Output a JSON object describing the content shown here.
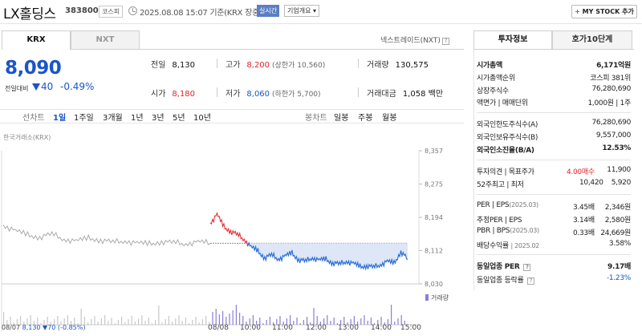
{
  "header": {
    "stock_name": "LX홀딩스",
    "stock_code": "383800",
    "market": "코스피",
    "date_text": "2025.08.08 15:07 기준(KRX 장중)",
    "realtime": "실시간",
    "company_info": "기업개요 ▾",
    "mystock_plus": "+",
    "mystock_label": "MY STOCK 추가"
  },
  "tabs": {
    "krx": "KRX",
    "nxt": "NXT",
    "nxt_link": "넥스트레이드(NXT)",
    "help": "?"
  },
  "price": {
    "current": "8,090",
    "change_label": "전일대비",
    "change_value": "40",
    "change_pct": "-0.49%"
  },
  "stats": {
    "prev_close_label": "전일",
    "prev_close": "8,130",
    "high_label": "고가",
    "high": "8,200",
    "upper_limit": "(상한가 10,560)",
    "volume_label": "거래량",
    "volume": "130,575",
    "open_label": "시가",
    "open": "8,180",
    "low_label": "저가",
    "low": "8,060",
    "lower_limit": "(하한가 5,700)",
    "amount_label": "거래대금",
    "amount": "1,058 백만"
  },
  "period": {
    "line_label": "선차트",
    "items": [
      "1일",
      "1주일",
      "3개월",
      "1년",
      "3년",
      "5년",
      "10년"
    ],
    "bong_label": "봉차트",
    "bong_items": [
      "일봉",
      "주봉",
      "월봉"
    ]
  },
  "chart_data": {
    "type": "line",
    "title": "한국거래소(KRX)",
    "y_ticks": [
      "8,357",
      "8,275",
      "8,194",
      "8,112",
      "8,030"
    ],
    "ylim": [
      8030,
      8357
    ],
    "x_ticks": [
      "08/07",
      "08/08",
      "10:00",
      "11:00",
      "12:00",
      "13:00",
      "14:00",
      "15:00"
    ],
    "prev_day_label": "08/07",
    "prev_day_close": "8,130",
    "prev_day_change": "▼70 (-0.85%)",
    "volume_label": "거래량",
    "reference_price": 8130,
    "series": [
      {
        "name": "08/07",
        "values": [
          8175,
          8160,
          8150,
          8145,
          8152,
          8140,
          8135,
          8142,
          8138,
          8132,
          8136,
          8130,
          8128,
          8134,
          8131,
          8129,
          8133,
          8130
        ]
      },
      {
        "name": "08/08",
        "values": [
          8180,
          8200,
          8170,
          8160,
          8150,
          8140,
          8120,
          8110,
          8095,
          8100,
          8092,
          8098,
          8105,
          8090,
          8085,
          8095,
          8088,
          8090,
          8082,
          8078,
          8086,
          8080,
          8072,
          8075,
          8070,
          8078,
          8085,
          8080,
          8110,
          8090
        ]
      }
    ]
  },
  "info": {
    "tab_info": "투자정보",
    "tab_order": "호가10단계",
    "market_cap_label": "시가총액",
    "market_cap": "6,171억원",
    "rank_label": "시가총액순위",
    "rank": "코스피 381위",
    "shares_label": "상장주식수",
    "shares": "76,280,690",
    "par_label": "액면가 | 매매단위",
    "par": "1,000원 | 1주",
    "foreign_limit_label": "외국인한도주식수(A)",
    "foreign_limit": "76,280,690",
    "foreign_hold_label": "외국인보유주식수(B)",
    "foreign_hold": "9,557,000",
    "foreign_ratio_label": "외국인소진율(B/A)",
    "foreign_ratio": "12.53%",
    "opinion_label": "투자의견 | 목표주가",
    "opinion": "4.00매수",
    "target": "11,900",
    "w52_label": "52주최고 | 최저",
    "w52_high": "10,420",
    "w52_low": "5,920",
    "per_label": "PER | EPS",
    "per_date": "(2025.03)",
    "per": "3.45배",
    "eps": "2,346원",
    "est_per_label": "추정PER | EPS",
    "est_per": "3.14배",
    "est_eps": "2,580원",
    "pbr_label": "PBR | BPS",
    "pbr_date": "(2025.03)",
    "pbr": "0.33배",
    "bps": "24,669원",
    "div_label": "배당수익률",
    "div_date": "| 2025.02",
    "div": "3.58%",
    "sector_per_label": "동일업종 PER",
    "sector_per": "9.17배",
    "sector_change_label": "동일업종 등락률",
    "sector_change": "-1.23%"
  }
}
